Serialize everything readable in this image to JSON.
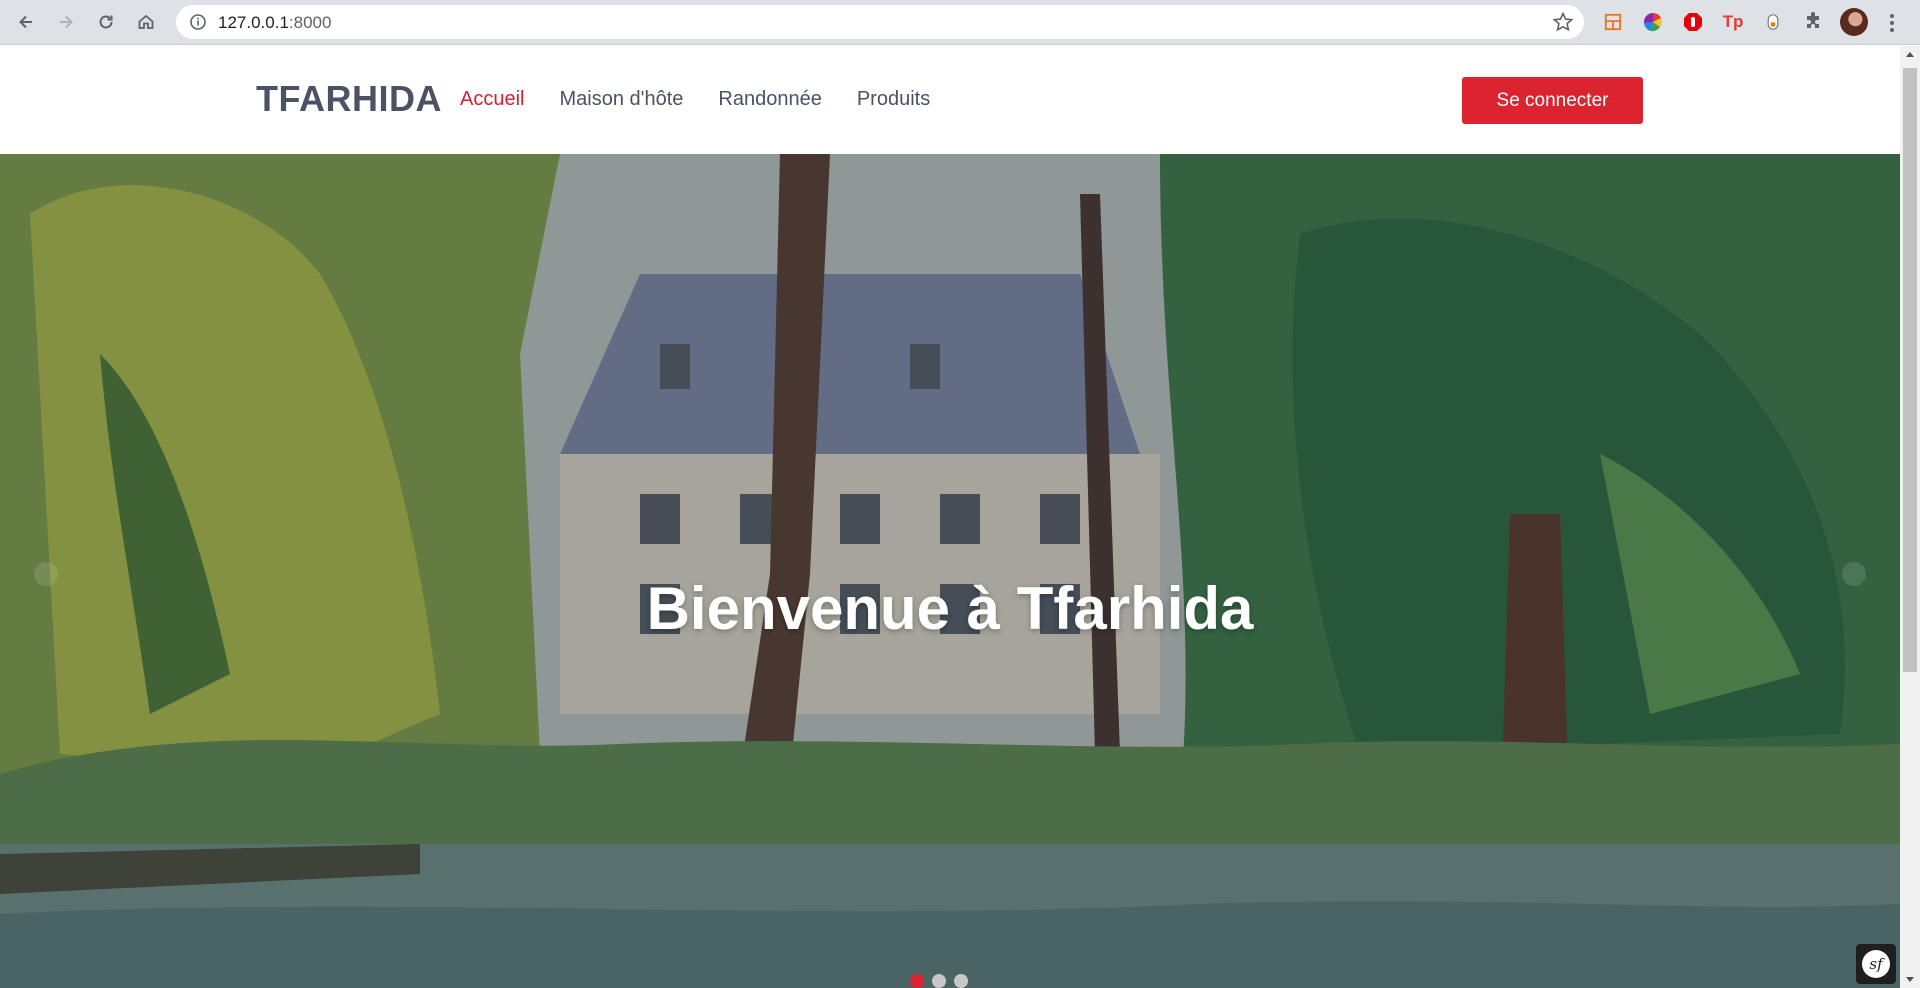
{
  "browser": {
    "url_host": "127.0.0.1",
    "url_port": ":8000"
  },
  "site": {
    "brand": "TFARHIDA",
    "nav": [
      {
        "label": "Accueil",
        "active": true
      },
      {
        "label": "Maison d'hôte",
        "active": false
      },
      {
        "label": "Randonnée",
        "active": false
      },
      {
        "label": "Produits",
        "active": false
      }
    ],
    "login_label": "Se connecter"
  },
  "hero": {
    "title": "Bienvenue à Tfarhida",
    "slides_count": 3,
    "active_slide": 1
  },
  "colors": {
    "accent": "#dc2330",
    "nav_text": "#4b5264"
  },
  "icons": {
    "back": "back-arrow-icon",
    "forward": "forward-arrow-icon",
    "reload": "reload-icon",
    "home": "home-icon",
    "info": "info-icon",
    "bookmark": "star-icon",
    "extensions": "puzzle-icon",
    "menu": "kebab-menu-icon",
    "framework": "symfony-icon"
  }
}
